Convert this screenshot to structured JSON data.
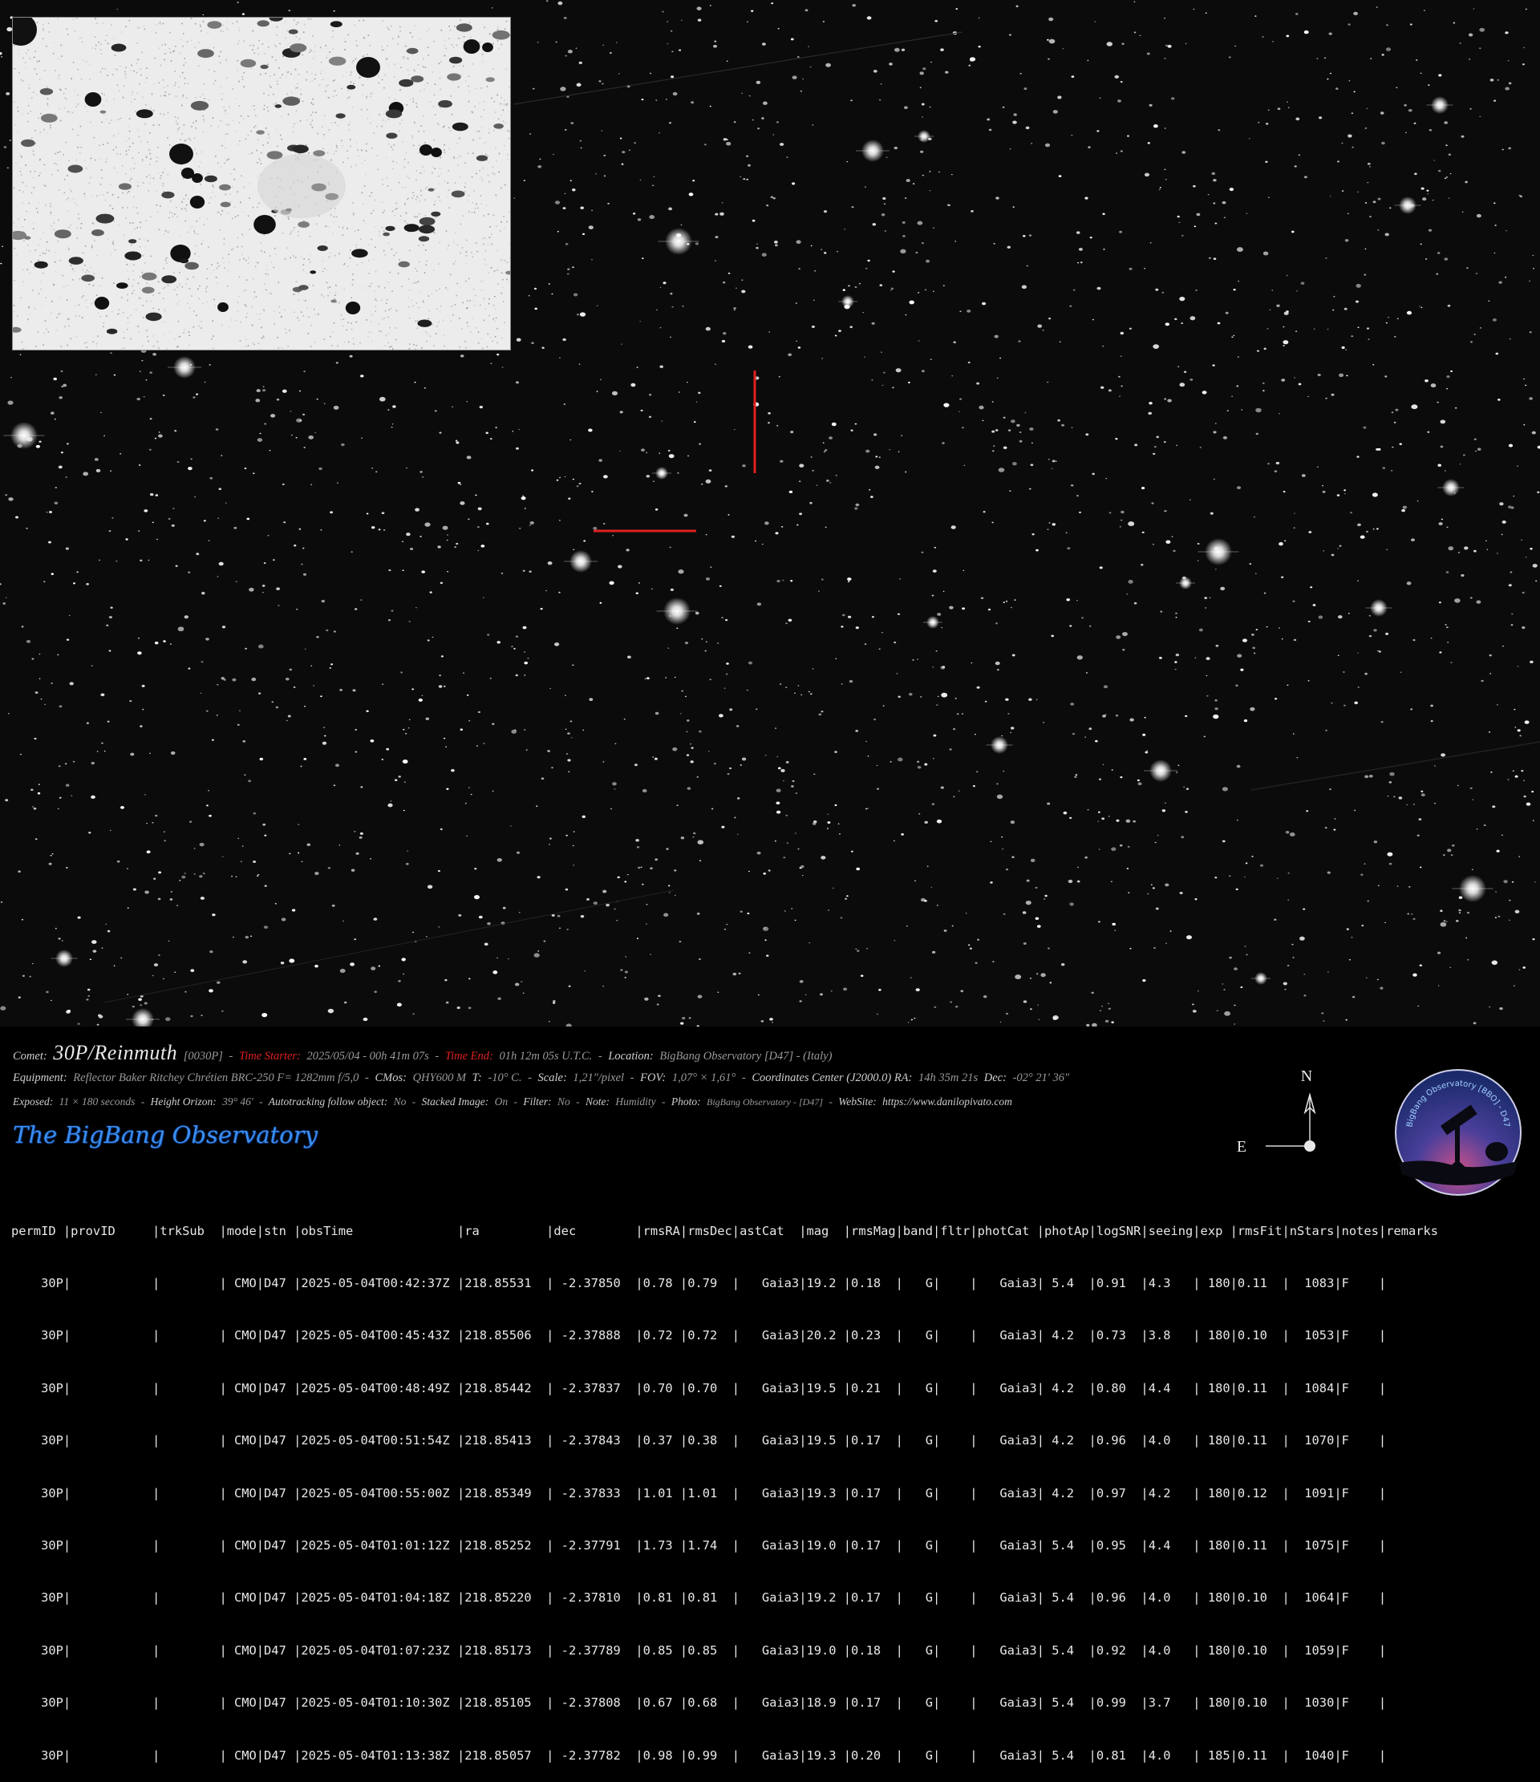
{
  "image": {
    "type": "astronomical-photograph",
    "subject": "comet 30P/Reinmuth star field",
    "marker_color": "#e02020"
  },
  "caption": {
    "comet_label": "Comet:",
    "comet_name": "30P/Reinmuth",
    "comet_code": "[0030P]",
    "time_start_label": "Time Starter:",
    "time_start_value": "2025/05/04  -  00h 41m 07s",
    "time_end_label": "Time End:",
    "time_end_value": "01h  12m 05s  U.T.C.",
    "location_label": "Location:",
    "location_value": "BigBang Observatory  [D47] - (Italy)",
    "equipment_label": "Equipment:",
    "equipment_value": "Reflector Baker Ritchey Chrétien BRC-250  F= 1282mm f/5,0",
    "cmos_label": "CMos:",
    "cmos_value": "QHY600 M",
    "temp_label": "T:",
    "temp_value": "-10° C.",
    "scale_label": "Scale:",
    "scale_value": "1,21\"/pixel",
    "fov_label": "FOV:",
    "fov_value": "1,07° × 1,61°",
    "coords_label": "Coordinates Center (J2000.0) RA:",
    "ra_value": "14h 35m 21s",
    "dec_label": "Dec:",
    "dec_value": "-02° 21' 36\"",
    "exposed_label": "Exposed:",
    "exposed_value": "11 × 180 seconds",
    "height_label": "Height Orizon:",
    "height_value": "39° 46'",
    "autotrack_label": "Autotracking follow object:",
    "autotrack_value": "No",
    "stacked_label": "Stacked Image:",
    "stacked_value": "On",
    "filter_label": "Filter:",
    "filter_value": "No",
    "note_label": "Note:",
    "note_value": "Humidity",
    "photo_label": "Photo:",
    "photo_value": "BigBang Observatory - [D47]",
    "website_label": "WebSite:",
    "website_value": "https://www.danilopivato.com"
  },
  "brand": "The BigBang Observatory",
  "compass": {
    "north": "N",
    "east": "E"
  },
  "logo_text": "BigBang Observatory [BBO] - D47",
  "table": {
    "header": "permID |provID     |trkSub  |mode|stn |obsTime              |ra         |dec        |rmsRA|rmsDec|astCat  |mag  |rmsMag|band|fltr|photCat |photAp|logSNR|seeing|exp |rmsFit|nStars|notes|remarks",
    "rows": [
      "    30P|           |        | CMO|D47 |2025-05-04T00:42:37Z |218.85531  | -2.37850  |0.78 |0.79  |   Gaia3|19.2 |0.18  |   G|    |   Gaia3| 5.4  |0.91  |4.3   | 180|0.11  |  1083|F    |",
      "    30P|           |        | CMO|D47 |2025-05-04T00:45:43Z |218.85506  | -2.37888  |0.72 |0.72  |   Gaia3|20.2 |0.23  |   G|    |   Gaia3| 4.2  |0.73  |3.8   | 180|0.10  |  1053|F    |",
      "    30P|           |        | CMO|D47 |2025-05-04T00:48:49Z |218.85442  | -2.37837  |0.70 |0.70  |   Gaia3|19.5 |0.21  |   G|    |   Gaia3| 4.2  |0.80  |4.4   | 180|0.11  |  1084|F    |",
      "    30P|           |        | CMO|D47 |2025-05-04T00:51:54Z |218.85413  | -2.37843  |0.37 |0.38  |   Gaia3|19.5 |0.17  |   G|    |   Gaia3| 4.2  |0.96  |4.0   | 180|0.11  |  1070|F    |",
      "    30P|           |        | CMO|D47 |2025-05-04T00:55:00Z |218.85349  | -2.37833  |1.01 |1.01  |   Gaia3|19.3 |0.17  |   G|    |   Gaia3| 4.2  |0.97  |4.2   | 180|0.12  |  1091|F    |",
      "    30P|           |        | CMO|D47 |2025-05-04T01:01:12Z |218.85252  | -2.37791  |1.73 |1.74  |   Gaia3|19.0 |0.17  |   G|    |   Gaia3| 5.4  |0.95  |4.4   | 180|0.11  |  1075|F    |",
      "    30P|           |        | CMO|D47 |2025-05-04T01:04:18Z |218.85220  | -2.37810  |0.81 |0.81  |   Gaia3|19.2 |0.17  |   G|    |   Gaia3| 5.4  |0.96  |4.0   | 180|0.10  |  1064|F    |",
      "    30P|           |        | CMO|D47 |2025-05-04T01:07:23Z |218.85173  | -2.37789  |0.85 |0.85  |   Gaia3|19.0 |0.18  |   G|    |   Gaia3| 5.4  |0.92  |4.0   | 180|0.10  |  1059|F    |",
      "    30P|           |        | CMO|D47 |2025-05-04T01:10:30Z |218.85105  | -2.37808  |0.67 |0.68  |   Gaia3|18.9 |0.17  |   G|    |   Gaia3| 5.4  |0.99  |3.7   | 180|0.10  |  1030|F    |",
      "    30P|           |        | CMO|D47 |2025-05-04T01:13:38Z |218.85057  | -2.37782  |0.98 |0.99  |   Gaia3|19.3 |0.20  |   G|    |   Gaia3| 5.4  |0.81  |4.0   | 185|0.11  |  1040|F    |"
    ]
  }
}
